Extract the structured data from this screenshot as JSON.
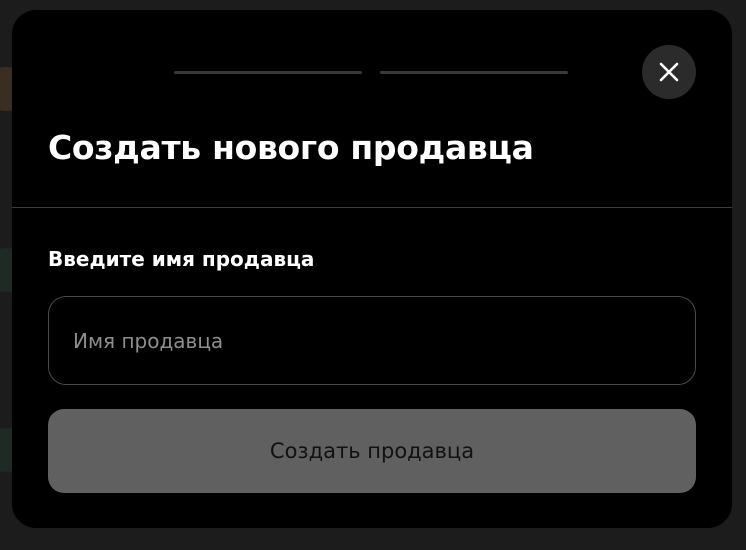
{
  "modal": {
    "title": "Создать нового продавца",
    "close_icon": "close-icon",
    "progress_steps": 2
  },
  "form": {
    "name_label": "Введите имя продавца",
    "name_placeholder": "Имя продавца",
    "name_value": "",
    "submit_label": "Создать продавца"
  },
  "colors": {
    "modal_background": "#000000",
    "backdrop": "#1c1c1c",
    "submit_disabled": "#606060",
    "close_button_bg": "#2b2b2b"
  }
}
